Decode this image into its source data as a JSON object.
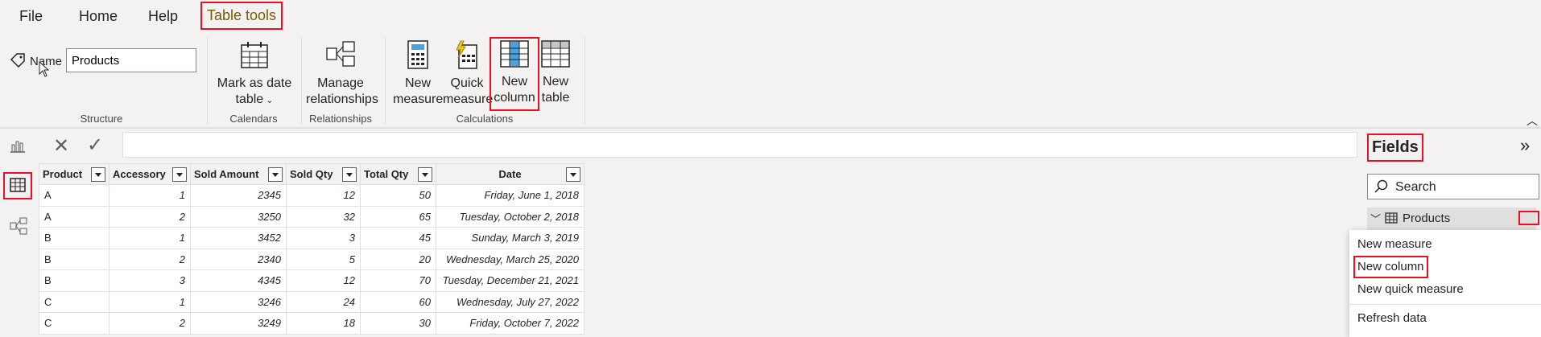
{
  "menu": {
    "file": "File",
    "home": "Home",
    "help": "Help",
    "table_tools": "Table tools"
  },
  "ribbon": {
    "name_label": "Name",
    "name_value": "Products",
    "structure_label": "Structure",
    "mark_date_line1": "Mark as date",
    "mark_date_line2": "table",
    "calendars_label": "Calendars",
    "manage_line1": "Manage",
    "manage_line2": "relationships",
    "relationships_label": "Relationships",
    "new_measure_line1": "New",
    "new_measure_line2": "measure",
    "quick_measure_line1": "Quick",
    "quick_measure_line2": "measure",
    "new_column_line1": "New",
    "new_column_line2": "column",
    "new_table_line1": "New",
    "new_table_line2": "table",
    "calculations_label": "Calculations"
  },
  "table": {
    "headers": [
      "Product",
      "Accessory",
      "Sold Amount",
      "Sold Qty",
      "Total Qty",
      "Date"
    ],
    "rows": [
      [
        "A",
        "1",
        "2345",
        "12",
        "50",
        "Friday, June 1, 2018"
      ],
      [
        "A",
        "2",
        "3250",
        "32",
        "65",
        "Tuesday, October 2, 2018"
      ],
      [
        "B",
        "1",
        "3452",
        "3",
        "45",
        "Sunday, March 3, 2019"
      ],
      [
        "B",
        "2",
        "2340",
        "5",
        "20",
        "Wednesday, March 25, 2020"
      ],
      [
        "B",
        "3",
        "4345",
        "12",
        "70",
        "Tuesday, December 21, 2021"
      ],
      [
        "C",
        "1",
        "3246",
        "24",
        "60",
        "Wednesday, July 27, 2022"
      ],
      [
        "C",
        "2",
        "3249",
        "18",
        "30",
        "Friday, October 7, 2022"
      ]
    ]
  },
  "fields": {
    "title": "Fields",
    "search_placeholder": "Search",
    "table_name": "Products"
  },
  "context_menu": {
    "new_measure": "New measure",
    "new_column": "New column",
    "new_quick_measure": "New quick measure",
    "refresh_data": "Refresh data"
  },
  "colors": {
    "highlight": "#e81123",
    "accent": "#7a5a00",
    "selected_icon": "#4aa3df"
  }
}
